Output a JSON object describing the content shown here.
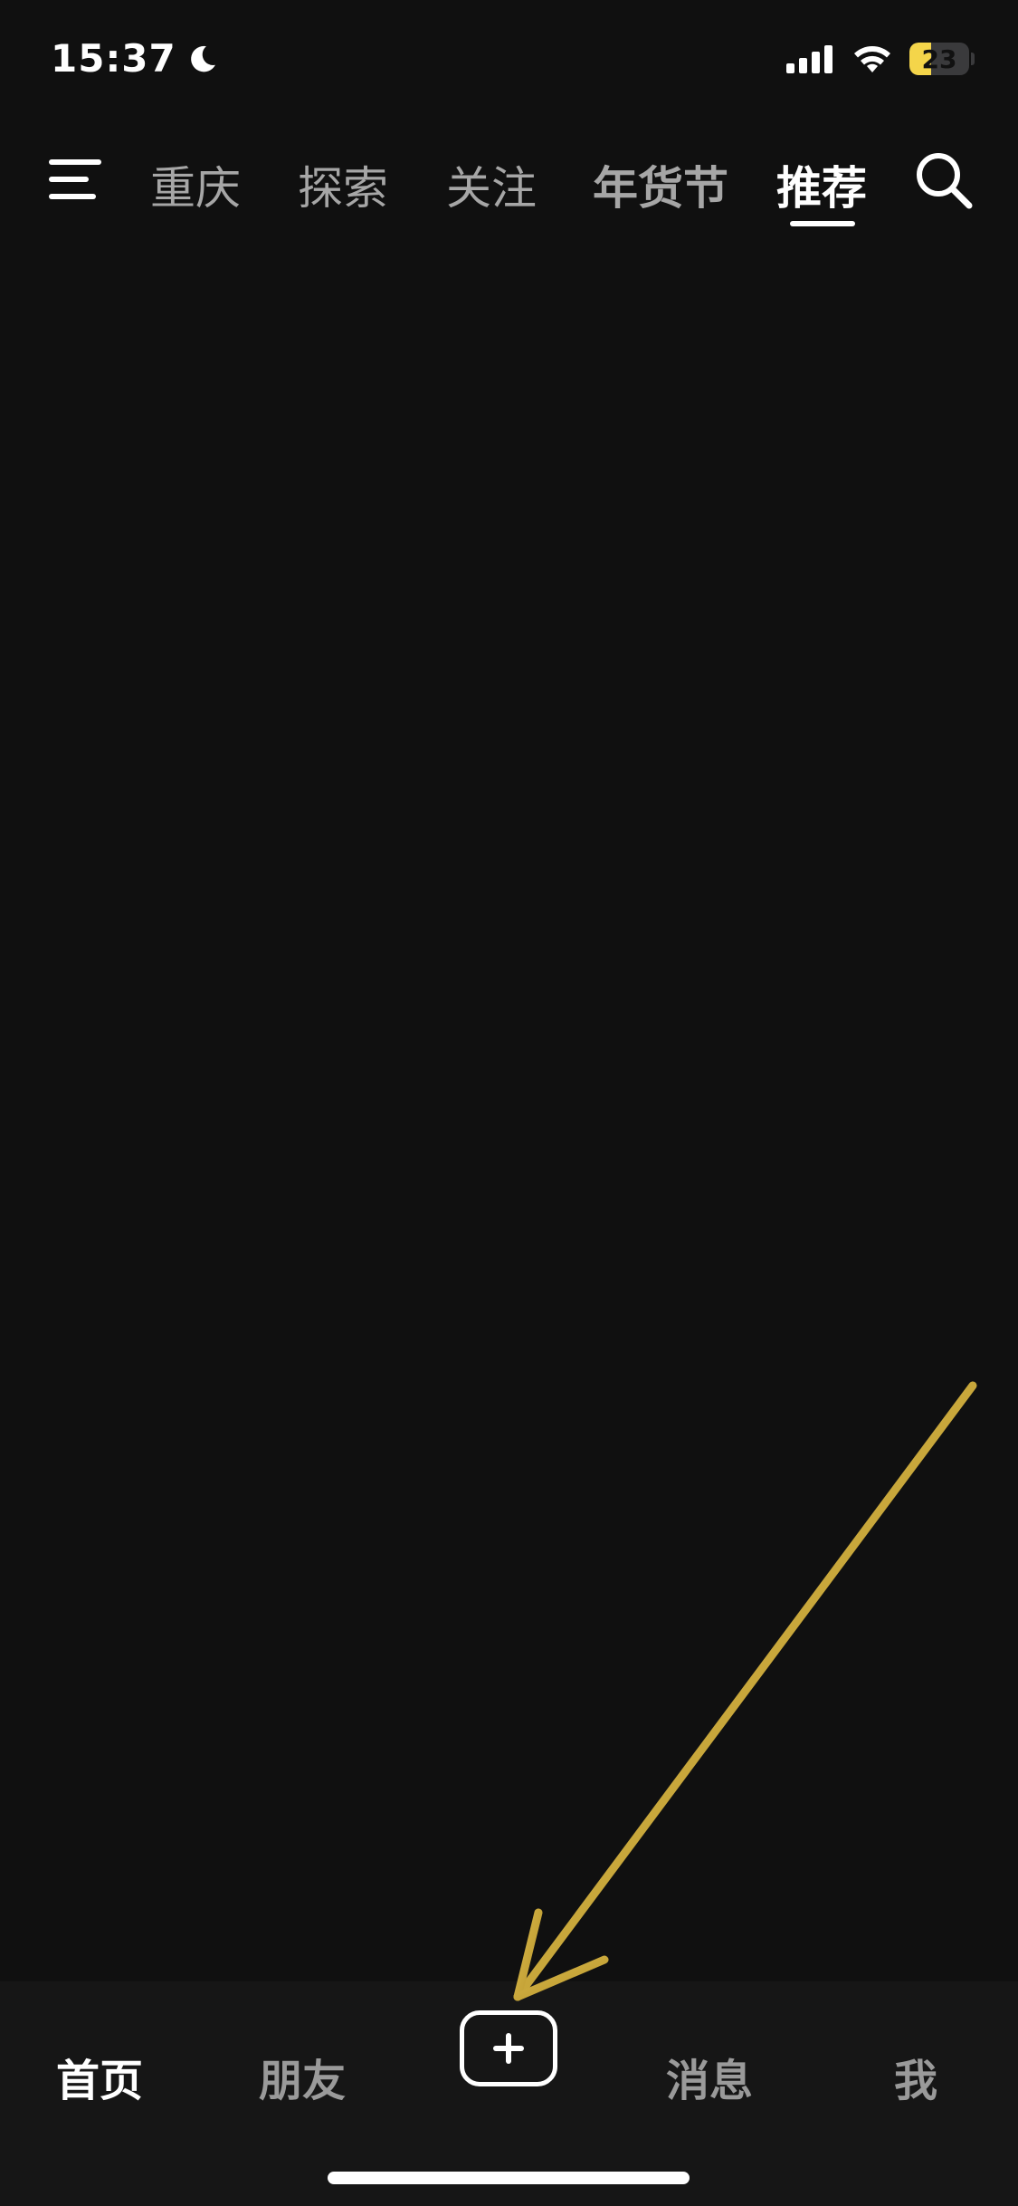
{
  "status_bar": {
    "time": "15:37",
    "battery_level": "23",
    "icons": [
      "moon-icon",
      "signal-icon",
      "wifi-icon",
      "battery-icon"
    ],
    "battery_color": "#f4d54a"
  },
  "top_nav": {
    "tabs": [
      {
        "label": "重庆"
      },
      {
        "label": "探索"
      },
      {
        "label": "关注"
      },
      {
        "label": "年货节"
      },
      {
        "label": "推荐"
      }
    ],
    "active_tab": "推荐",
    "icons": [
      "menu-icon",
      "search-icon"
    ]
  },
  "bottom_nav": {
    "tabs": [
      {
        "label": "首页"
      },
      {
        "label": "朋友"
      },
      {
        "label": "消息"
      },
      {
        "label": "我"
      }
    ],
    "active_tab": "首页",
    "add_icon": "plus-icon"
  },
  "annotation": {
    "type": "arrow",
    "color": "#c9a93a",
    "points_to": "add-button"
  },
  "colors": {
    "background": "#101010",
    "bottom_bar": "#161616",
    "inactive_text": "#a6a6a6",
    "active_text": "#ffffff"
  }
}
